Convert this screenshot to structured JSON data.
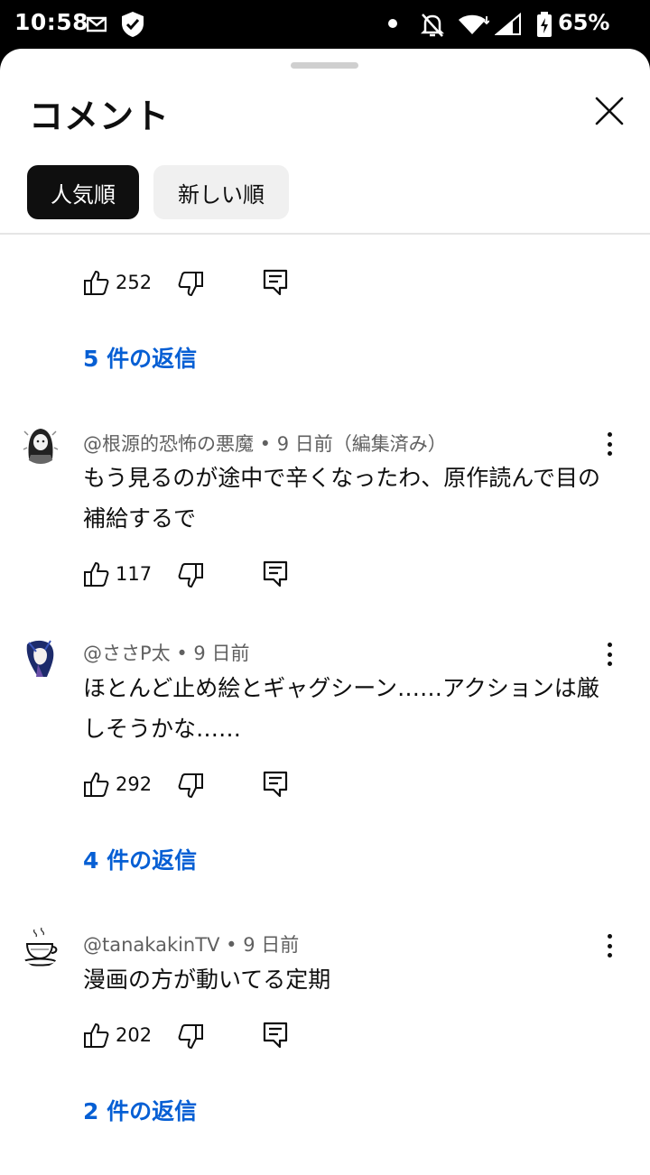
{
  "status_bar": {
    "time": "10:58",
    "battery": "65%",
    "icons": [
      "mail-icon",
      "shield-icon",
      "dot-icon",
      "bell-off-icon",
      "wifi-icon",
      "signal-icon",
      "battery-charging-icon"
    ]
  },
  "sheet": {
    "title": "コメント",
    "close_icon": "close-icon",
    "sort_chips": [
      {
        "label": "人気順",
        "selected": true
      },
      {
        "label": "新しい順",
        "selected": false
      }
    ]
  },
  "clipped_comment": {
    "partial_text": "…",
    "likes": "252",
    "replies_label": "5 件の返信"
  },
  "comments": [
    {
      "author": "@根源的恐怖の悪魔",
      "age": "9 日前",
      "edited": "（編集済み）",
      "text": "もう見るのが途中で辛くなったわ、原作読んで目の補給するで",
      "likes": "117"
    },
    {
      "author": "@ささP太",
      "age": "9 日前",
      "edited": "",
      "text": "ほとんど止め絵とギャグシーン……アクションは厳しそうかな……",
      "likes": "292",
      "replies_label": "4 件の返信"
    },
    {
      "author": "@tanakakinTV",
      "age": "9 日前",
      "edited": "",
      "text": "漫画の方が動いてる定期",
      "likes": "202",
      "replies_label": "2 件の返信"
    }
  ],
  "colors": {
    "link": "#065fd4",
    "chip_selected_bg": "#0f0f0f",
    "chip_bg": "#f0f0f0",
    "secondary_text": "#606060"
  }
}
